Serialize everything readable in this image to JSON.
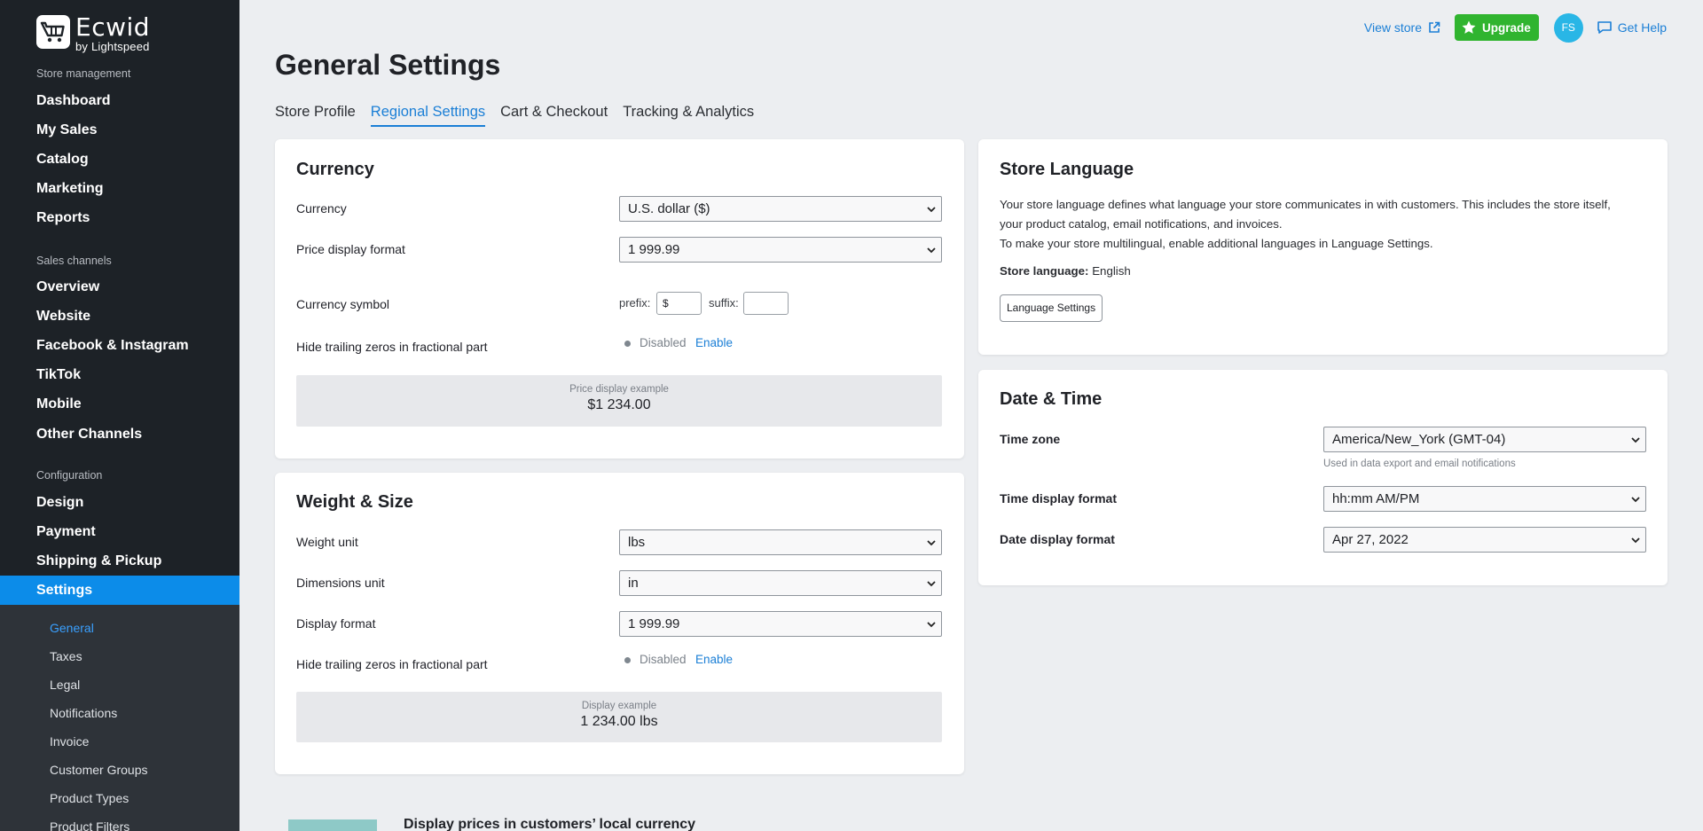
{
  "brand": {
    "name": "Ecwid",
    "by": "by Lightspeed"
  },
  "sidebar": {
    "section_store": "Store management",
    "store_items": [
      "Dashboard",
      "My Sales",
      "Catalog",
      "Marketing",
      "Reports"
    ],
    "section_channels": "Sales channels",
    "channel_items": [
      "Overview",
      "Website",
      "Facebook & Instagram",
      "TikTok",
      "Mobile",
      "Other Channels"
    ],
    "section_config": "Configuration",
    "config_items": [
      "Design",
      "Payment",
      "Shipping & Pickup",
      "Settings"
    ],
    "sub_items": [
      "General",
      "Taxes",
      "Legal",
      "Notifications",
      "Invoice",
      "Customer Groups",
      "Product Types",
      "Product Filters"
    ]
  },
  "topbar": {
    "view_store": "View store",
    "upgrade": "Upgrade",
    "avatar": "FS",
    "help": "Get Help"
  },
  "page": {
    "title": "General Settings",
    "tabs": [
      "Store Profile",
      "Regional Settings",
      "Cart & Checkout",
      "Tracking & Analytics"
    ]
  },
  "currency": {
    "title": "Currency",
    "currency_label": "Currency",
    "currency_value": "U.S. dollar ($)",
    "format_label": "Price display format",
    "format_value": "1 999.99",
    "symbol_label": "Currency symbol",
    "prefix_label": "prefix:",
    "prefix_value": "$",
    "suffix_label": "suffix:",
    "suffix_value": "",
    "zeros_label": "Hide trailing zeros in fractional part",
    "zeros_status": "Disabled",
    "zeros_enable": "Enable",
    "example_label": "Price display example",
    "example_value": "$1 234.00"
  },
  "weight": {
    "title": "Weight & Size",
    "weight_label": "Weight unit",
    "weight_value": "lbs",
    "dim_label": "Dimensions unit",
    "dim_value": "in",
    "format_label": "Display format",
    "format_value": "1 999.99",
    "zeros_label": "Hide trailing zeros in fractional part",
    "zeros_status": "Disabled",
    "zeros_enable": "Enable",
    "example_label": "Display example",
    "example_value": "1 234.00 lbs"
  },
  "language": {
    "title": "Store Language",
    "desc1": "Your store language defines what language your store communicates in with customers. This includes the store itself,",
    "desc2": "your product catalog, email notifications, and invoices.",
    "desc3": "To make your store multilingual, enable additional languages in Language Settings.",
    "store_lang_label": "Store language:",
    "store_lang_value": "English",
    "button": "Language Settings"
  },
  "datetime": {
    "title": "Date & Time",
    "tz_label": "Time zone",
    "tz_value": "America/New_York (GMT-04)",
    "tz_hint": "Used in data export and email notifications",
    "time_label": "Time display format",
    "time_value": "hh:mm AM/PM",
    "date_label": "Date display format",
    "date_value": "Apr 27, 2022"
  },
  "promo": {
    "title": "Display prices in customers’ local currency"
  }
}
